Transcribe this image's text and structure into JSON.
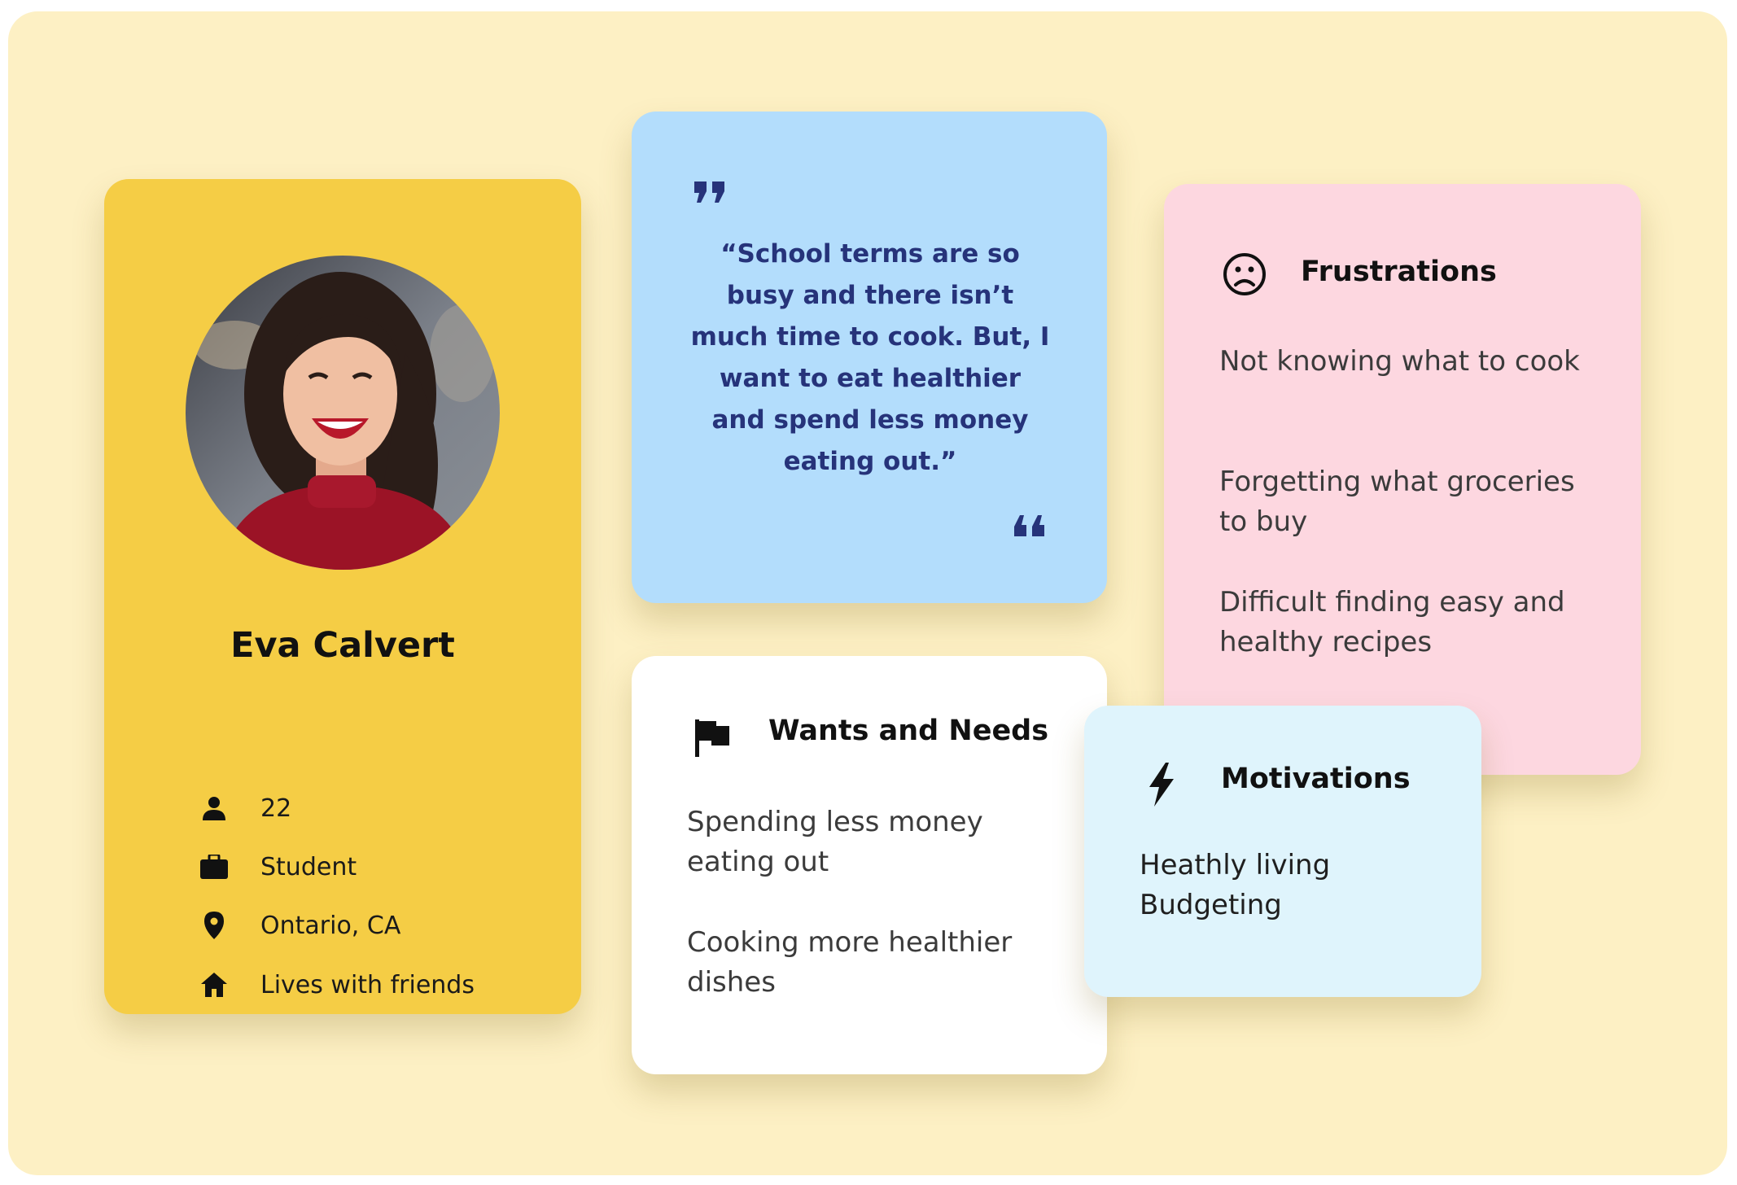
{
  "persona": {
    "name": "Eva Calvert",
    "details": [
      {
        "icon": "person-icon",
        "text": "22"
      },
      {
        "icon": "briefcase-icon",
        "text": "Student"
      },
      {
        "icon": "location-pin-icon",
        "text": "Ontario, CA"
      },
      {
        "icon": "home-icon",
        "text": "Lives with friends"
      }
    ]
  },
  "quote": {
    "text": "“School terms are so busy and there isn’t much time to cook. But, I want to eat healthier and spend less money eating out.”"
  },
  "frustrations": {
    "title": "Frustrations",
    "icon": "sad-face-icon",
    "items": [
      "Not knowing what to cook",
      "Forgetting what groceries to buy",
      "Difficult finding easy and healthy recipes"
    ]
  },
  "wants": {
    "title": "Wants and Needs",
    "icon": "flag-icon",
    "items": [
      "Spending less money eating out",
      "Cooking more healthier dishes"
    ]
  },
  "motivations": {
    "title": "Motivations",
    "icon": "lightning-bolt-icon",
    "items": [
      "Heathly living",
      "Budgeting"
    ]
  },
  "colors": {
    "background": "#fdf0c4",
    "profile_card": "#f5cd45",
    "quote_card": "#b3ddfc",
    "quote_text": "#26337a",
    "frustrations_card": "#fdd7e0",
    "wants_card": "#ffffff",
    "motivations_card": "#dff4fc"
  }
}
